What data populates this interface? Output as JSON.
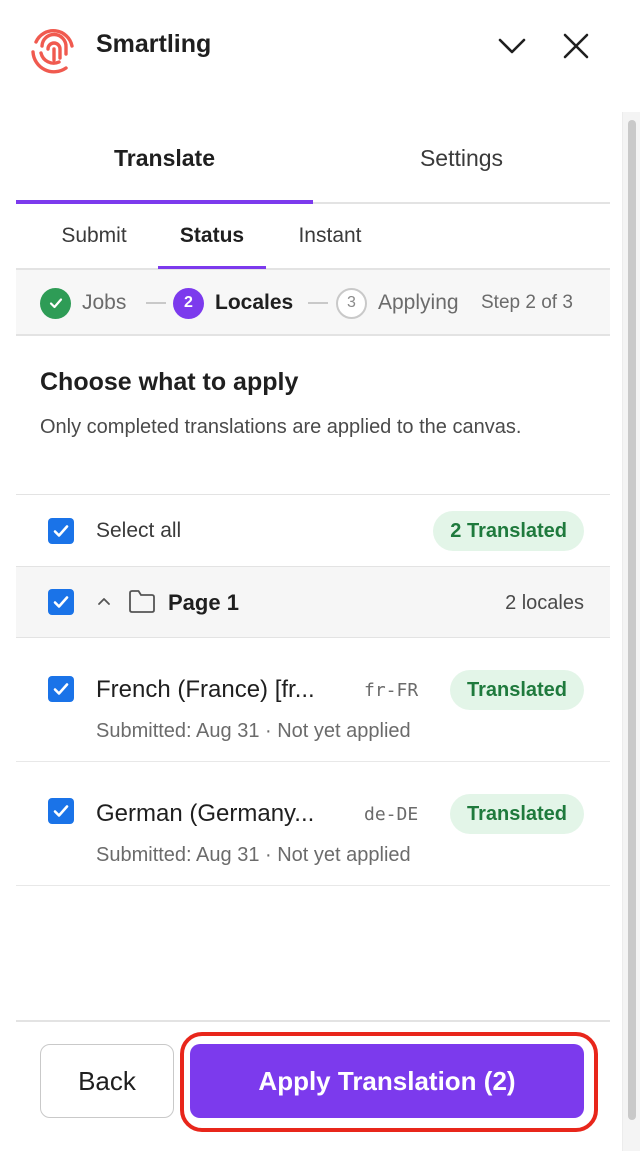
{
  "app": {
    "name": "Smartling",
    "accent_color": "#7c3aed",
    "logo_color": "#f05a4f"
  },
  "header": {
    "collapse_icon": "chevron-down-icon",
    "close_icon": "close-icon"
  },
  "tabs": [
    {
      "label": "Translate",
      "active": true
    },
    {
      "label": "Settings",
      "active": false
    }
  ],
  "subtabs": [
    {
      "label": "Submit",
      "active": false
    },
    {
      "label": "Status",
      "active": true
    },
    {
      "label": "Instant",
      "active": false
    }
  ],
  "stepper": {
    "steps": [
      {
        "label": "Jobs",
        "marker": "✓",
        "state": "done"
      },
      {
        "label": "Locales",
        "marker": "2",
        "state": "current"
      },
      {
        "label": "Applying",
        "marker": "3",
        "state": "pending"
      }
    ],
    "step_count": "Step 2 of 3"
  },
  "intro": {
    "title": "Choose what to apply",
    "description": "Only completed translations are applied to the canvas."
  },
  "select_all": {
    "label": "Select all",
    "checked": true,
    "badge": "2 Translated"
  },
  "page_group": {
    "name": "Page 1",
    "count": "2 locales",
    "checked": true,
    "expanded": true
  },
  "locales": [
    {
      "name": "French (France) [fr...",
      "code": "fr-FR",
      "status": "Translated",
      "meta": "Submitted: Aug 31 · Not yet applied",
      "checked": true
    },
    {
      "name": "German (Germany...",
      "code": "de-DE",
      "status": "Translated",
      "meta": "Submitted: Aug 31 · Not yet applied",
      "checked": true
    }
  ],
  "footer": {
    "back_label": "Back",
    "apply_label": "Apply Translation (2)"
  }
}
